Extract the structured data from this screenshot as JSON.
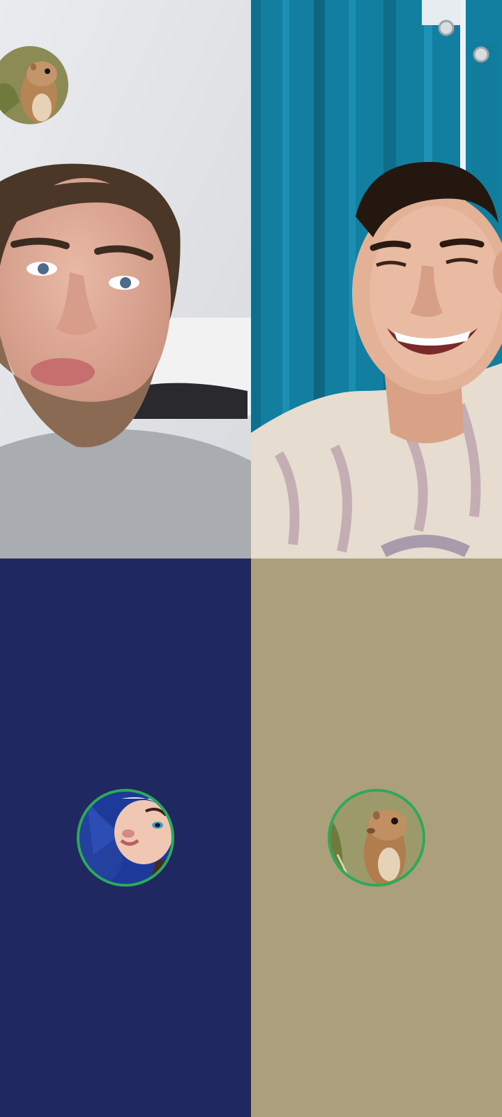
{
  "call": {
    "participants": [
      {
        "id": "p1",
        "type": "video",
        "position": "top-left",
        "mirror_self": true
      },
      {
        "id": "p2",
        "type": "video",
        "position": "top-right"
      },
      {
        "id": "p3",
        "type": "avatar",
        "position": "bottom-left",
        "background": "#1f2860",
        "avatar_icon": "woman-portrait-avatar"
      },
      {
        "id": "p4",
        "type": "avatar",
        "position": "bottom-right",
        "background": "#ab9f7c",
        "avatar_icon": "prairie-dog-avatar"
      }
    ],
    "self_view": {
      "avatar_icon": "prairie-dog-avatar"
    }
  },
  "colors": {
    "active_ring": "#2ea85a",
    "tile_blue": "#1f2860",
    "tile_tan": "#ab9f7c",
    "curtain_teal": "#137fa0"
  }
}
